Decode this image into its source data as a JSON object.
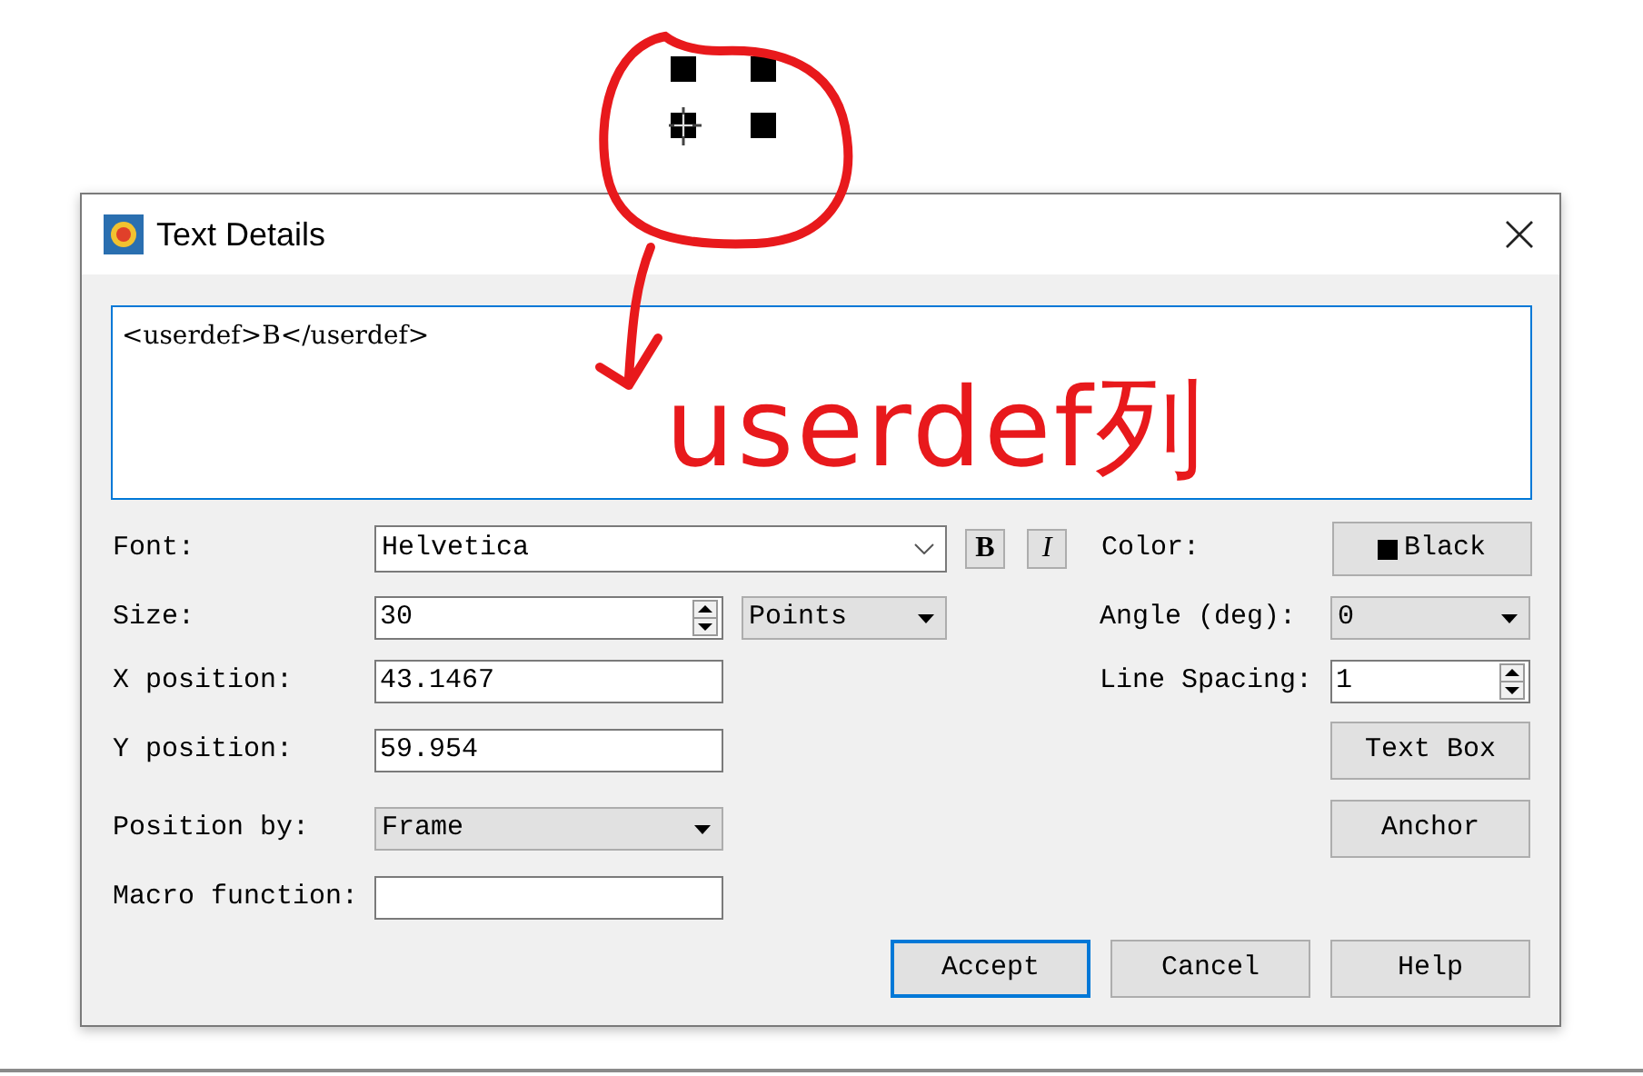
{
  "dialog": {
    "title": "Text Details",
    "text": "<userdef>B</userdef>",
    "font": {
      "label": "Font:",
      "value": "Helvetica",
      "bold_label": "B",
      "italic_label": "I"
    },
    "color": {
      "label": "Color:",
      "value": "Black"
    },
    "size": {
      "label": "Size:",
      "value": "30",
      "units": "Points"
    },
    "angle": {
      "label": "Angle (deg):",
      "value": "0"
    },
    "x_position": {
      "label": "X position:",
      "value": "43.1467"
    },
    "line_spacing": {
      "label": "Line Spacing:",
      "value": "1"
    },
    "y_position": {
      "label": "Y position:",
      "value": "59.954"
    },
    "text_box_button": "Text Box",
    "position_by": {
      "label": "Position by:",
      "value": "Frame"
    },
    "anchor_button": "Anchor",
    "macro_function": {
      "label": "Macro function:"
    },
    "buttons": [
      {
        "label": "Accept",
        "focused": true
      },
      {
        "label": "Cancel",
        "focused": false
      },
      {
        "label": "Help",
        "focused": false
      }
    ]
  },
  "annotation": {
    "text": "userdef列"
  }
}
